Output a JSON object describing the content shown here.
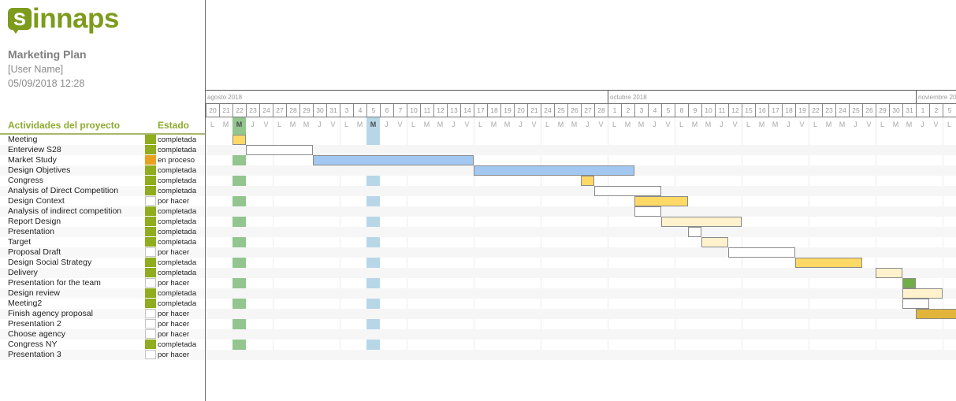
{
  "app": {
    "logo_mark": "s",
    "logo_text": "innaps"
  },
  "project": {
    "title": "Marketing Plan",
    "user": "[User Name]",
    "datetime": "05/09/2018 12:28"
  },
  "table_headers": {
    "activities": "Actividades del proyecto",
    "status": "Estado"
  },
  "status_colors": {
    "completada": "#8fad1f",
    "en proceso": "#e8a020",
    "por hacer": "#ffffff"
  },
  "bar_colors": {
    "yellow": "#ffd966",
    "white": "#ffffff",
    "blue": "#a2c8f2",
    "light-yellow": "#fff2cc",
    "green": "#70ad47",
    "gold": "#e2b53a"
  },
  "timeline": {
    "months": [
      {
        "label": "agosto 2018",
        "days": 30
      },
      {
        "label": "octubre 2018",
        "days": 23
      },
      {
        "label": "noviembre 20",
        "days": 3
      }
    ],
    "days": [
      [
        "2018-08-20",
        "20",
        "L"
      ],
      [
        "2018-08-21",
        "21",
        "M"
      ],
      [
        "2018-08-22",
        "22",
        "M"
      ],
      [
        "2018-08-23",
        "23",
        "J"
      ],
      [
        "2018-08-24",
        "24",
        "V"
      ],
      [
        "2018-08-27",
        "27",
        "L"
      ],
      [
        "2018-08-28",
        "28",
        "M"
      ],
      [
        "2018-08-29",
        "29",
        "M"
      ],
      [
        "2018-08-30",
        "30",
        "J"
      ],
      [
        "2018-08-31",
        "31",
        "V"
      ],
      [
        "2018-09-03",
        "3",
        "L"
      ],
      [
        "2018-09-04",
        "4",
        "M"
      ],
      [
        "2018-09-05",
        "5",
        "M"
      ],
      [
        "2018-09-06",
        "6",
        "J"
      ],
      [
        "2018-09-07",
        "7",
        "V"
      ],
      [
        "2018-09-10",
        "10",
        "L"
      ],
      [
        "2018-09-11",
        "11",
        "M"
      ],
      [
        "2018-09-12",
        "12",
        "M"
      ],
      [
        "2018-09-13",
        "13",
        "J"
      ],
      [
        "2018-09-14",
        "14",
        "V"
      ],
      [
        "2018-09-17",
        "17",
        "L"
      ],
      [
        "2018-09-18",
        "18",
        "M"
      ],
      [
        "2018-09-19",
        "19",
        "M"
      ],
      [
        "2018-09-20",
        "20",
        "J"
      ],
      [
        "2018-09-21",
        "21",
        "V"
      ],
      [
        "2018-09-24",
        "24",
        "L"
      ],
      [
        "2018-09-25",
        "25",
        "M"
      ],
      [
        "2018-09-26",
        "26",
        "M"
      ],
      [
        "2018-09-27",
        "27",
        "J"
      ],
      [
        "2018-09-28",
        "28",
        "V"
      ],
      [
        "2018-10-01",
        "1",
        "L"
      ],
      [
        "2018-10-02",
        "2",
        "M"
      ],
      [
        "2018-10-03",
        "3",
        "M"
      ],
      [
        "2018-10-04",
        "4",
        "J"
      ],
      [
        "2018-10-05",
        "5",
        "V"
      ],
      [
        "2018-10-08",
        "8",
        "L"
      ],
      [
        "2018-10-09",
        "9",
        "M"
      ],
      [
        "2018-10-10",
        "10",
        "M"
      ],
      [
        "2018-10-11",
        "11",
        "J"
      ],
      [
        "2018-10-12",
        "12",
        "V"
      ],
      [
        "2018-10-15",
        "15",
        "L"
      ],
      [
        "2018-10-16",
        "16",
        "M"
      ],
      [
        "2018-10-17",
        "17",
        "M"
      ],
      [
        "2018-10-18",
        "18",
        "J"
      ],
      [
        "2018-10-19",
        "19",
        "V"
      ],
      [
        "2018-10-22",
        "22",
        "L"
      ],
      [
        "2018-10-23",
        "23",
        "M"
      ],
      [
        "2018-10-24",
        "24",
        "M"
      ],
      [
        "2018-10-25",
        "25",
        "J"
      ],
      [
        "2018-10-26",
        "26",
        "V"
      ],
      [
        "2018-10-29",
        "29",
        "L"
      ],
      [
        "2018-10-30",
        "30",
        "M"
      ],
      [
        "2018-10-31",
        "31",
        "M"
      ],
      [
        "2018-11-01",
        "1",
        "J"
      ],
      [
        "2018-11-02",
        "2",
        "V"
      ],
      [
        "2018-11-05",
        "5",
        "L"
      ]
    ],
    "markers": [
      {
        "name": "today-marker",
        "date": "2018-08-22",
        "color": "#93c68f"
      },
      {
        "name": "highlight-marker",
        "date": "2018-09-05",
        "color": "#b7d7e8"
      }
    ]
  },
  "activities": [
    {
      "name": "Meeting",
      "status": "completada",
      "bar": {
        "start": "2018-08-22",
        "end": "2018-08-22",
        "color": "yellow"
      }
    },
    {
      "name": "Enterview S28",
      "status": "completada",
      "bar": {
        "start": "2018-08-23",
        "end": "2018-08-29",
        "color": "white"
      }
    },
    {
      "name": "Market Study",
      "status": "en proceso",
      "bar": {
        "start": "2018-08-30",
        "end": "2018-09-14",
        "color": "blue"
      }
    },
    {
      "name": "Design Objetives",
      "status": "completada",
      "bar": {
        "start": "2018-09-17",
        "end": "2018-10-02",
        "color": "blue"
      }
    },
    {
      "name": "Congress",
      "status": "completada",
      "bar": {
        "start": "2018-09-27",
        "end": "2018-09-27",
        "color": "yellow"
      }
    },
    {
      "name": "Analysis of Direct Competition",
      "status": "completada",
      "bar": {
        "start": "2018-09-28",
        "end": "2018-10-04",
        "color": "white"
      }
    },
    {
      "name": "Design Context",
      "status": "por hacer",
      "bar": {
        "start": "2018-10-03",
        "end": "2018-10-08",
        "color": "yellow"
      }
    },
    {
      "name": "Analysis of indirect competition",
      "status": "completada",
      "bar": {
        "start": "2018-10-03",
        "end": "2018-10-04",
        "color": "white"
      }
    },
    {
      "name": "Report Design",
      "status": "completada",
      "bar": {
        "start": "2018-10-05",
        "end": "2018-10-12",
        "color": "light-yellow"
      }
    },
    {
      "name": "Presentation",
      "status": "completada",
      "bar": {
        "start": "2018-10-09",
        "end": "2018-10-09",
        "color": "white"
      }
    },
    {
      "name": "Target",
      "status": "completada",
      "bar": {
        "start": "2018-10-10",
        "end": "2018-10-11",
        "color": "light-yellow"
      }
    },
    {
      "name": "Proposal Draft",
      "status": "por hacer",
      "bar": {
        "start": "2018-10-12",
        "end": "2018-10-18",
        "color": "white"
      }
    },
    {
      "name": "Design Social Strategy",
      "status": "completada",
      "bar": {
        "start": "2018-10-19",
        "end": "2018-10-25",
        "color": "yellow"
      }
    },
    {
      "name": "Delivery",
      "status": "completada",
      "bar": {
        "start": "2018-10-29",
        "end": "2018-10-30",
        "color": "light-yellow"
      }
    },
    {
      "name": "Presentation for the team",
      "status": "por hacer",
      "bar": {
        "start": "2018-10-31",
        "end": "2018-10-31",
        "color": "green"
      }
    },
    {
      "name": "Design review",
      "status": "completada",
      "bar": {
        "start": "2018-10-31",
        "end": "2018-11-02",
        "color": "light-yellow"
      }
    },
    {
      "name": "Meeting2",
      "status": "completada",
      "bar": {
        "start": "2018-10-31",
        "end": "2018-11-01",
        "color": "white"
      }
    },
    {
      "name": "Finish agency proposal",
      "status": "por hacer",
      "bar": {
        "start": "2018-11-01",
        "end": "2018-11-05",
        "color": "gold"
      }
    },
    {
      "name": "Presentation 2",
      "status": "por hacer",
      "bar": null
    },
    {
      "name": "Choose agency",
      "status": "por hacer",
      "bar": null
    },
    {
      "name": "Congress NY",
      "status": "completada",
      "bar": null
    },
    {
      "name": "Presentation 3",
      "status": "por hacer",
      "bar": null
    }
  ]
}
